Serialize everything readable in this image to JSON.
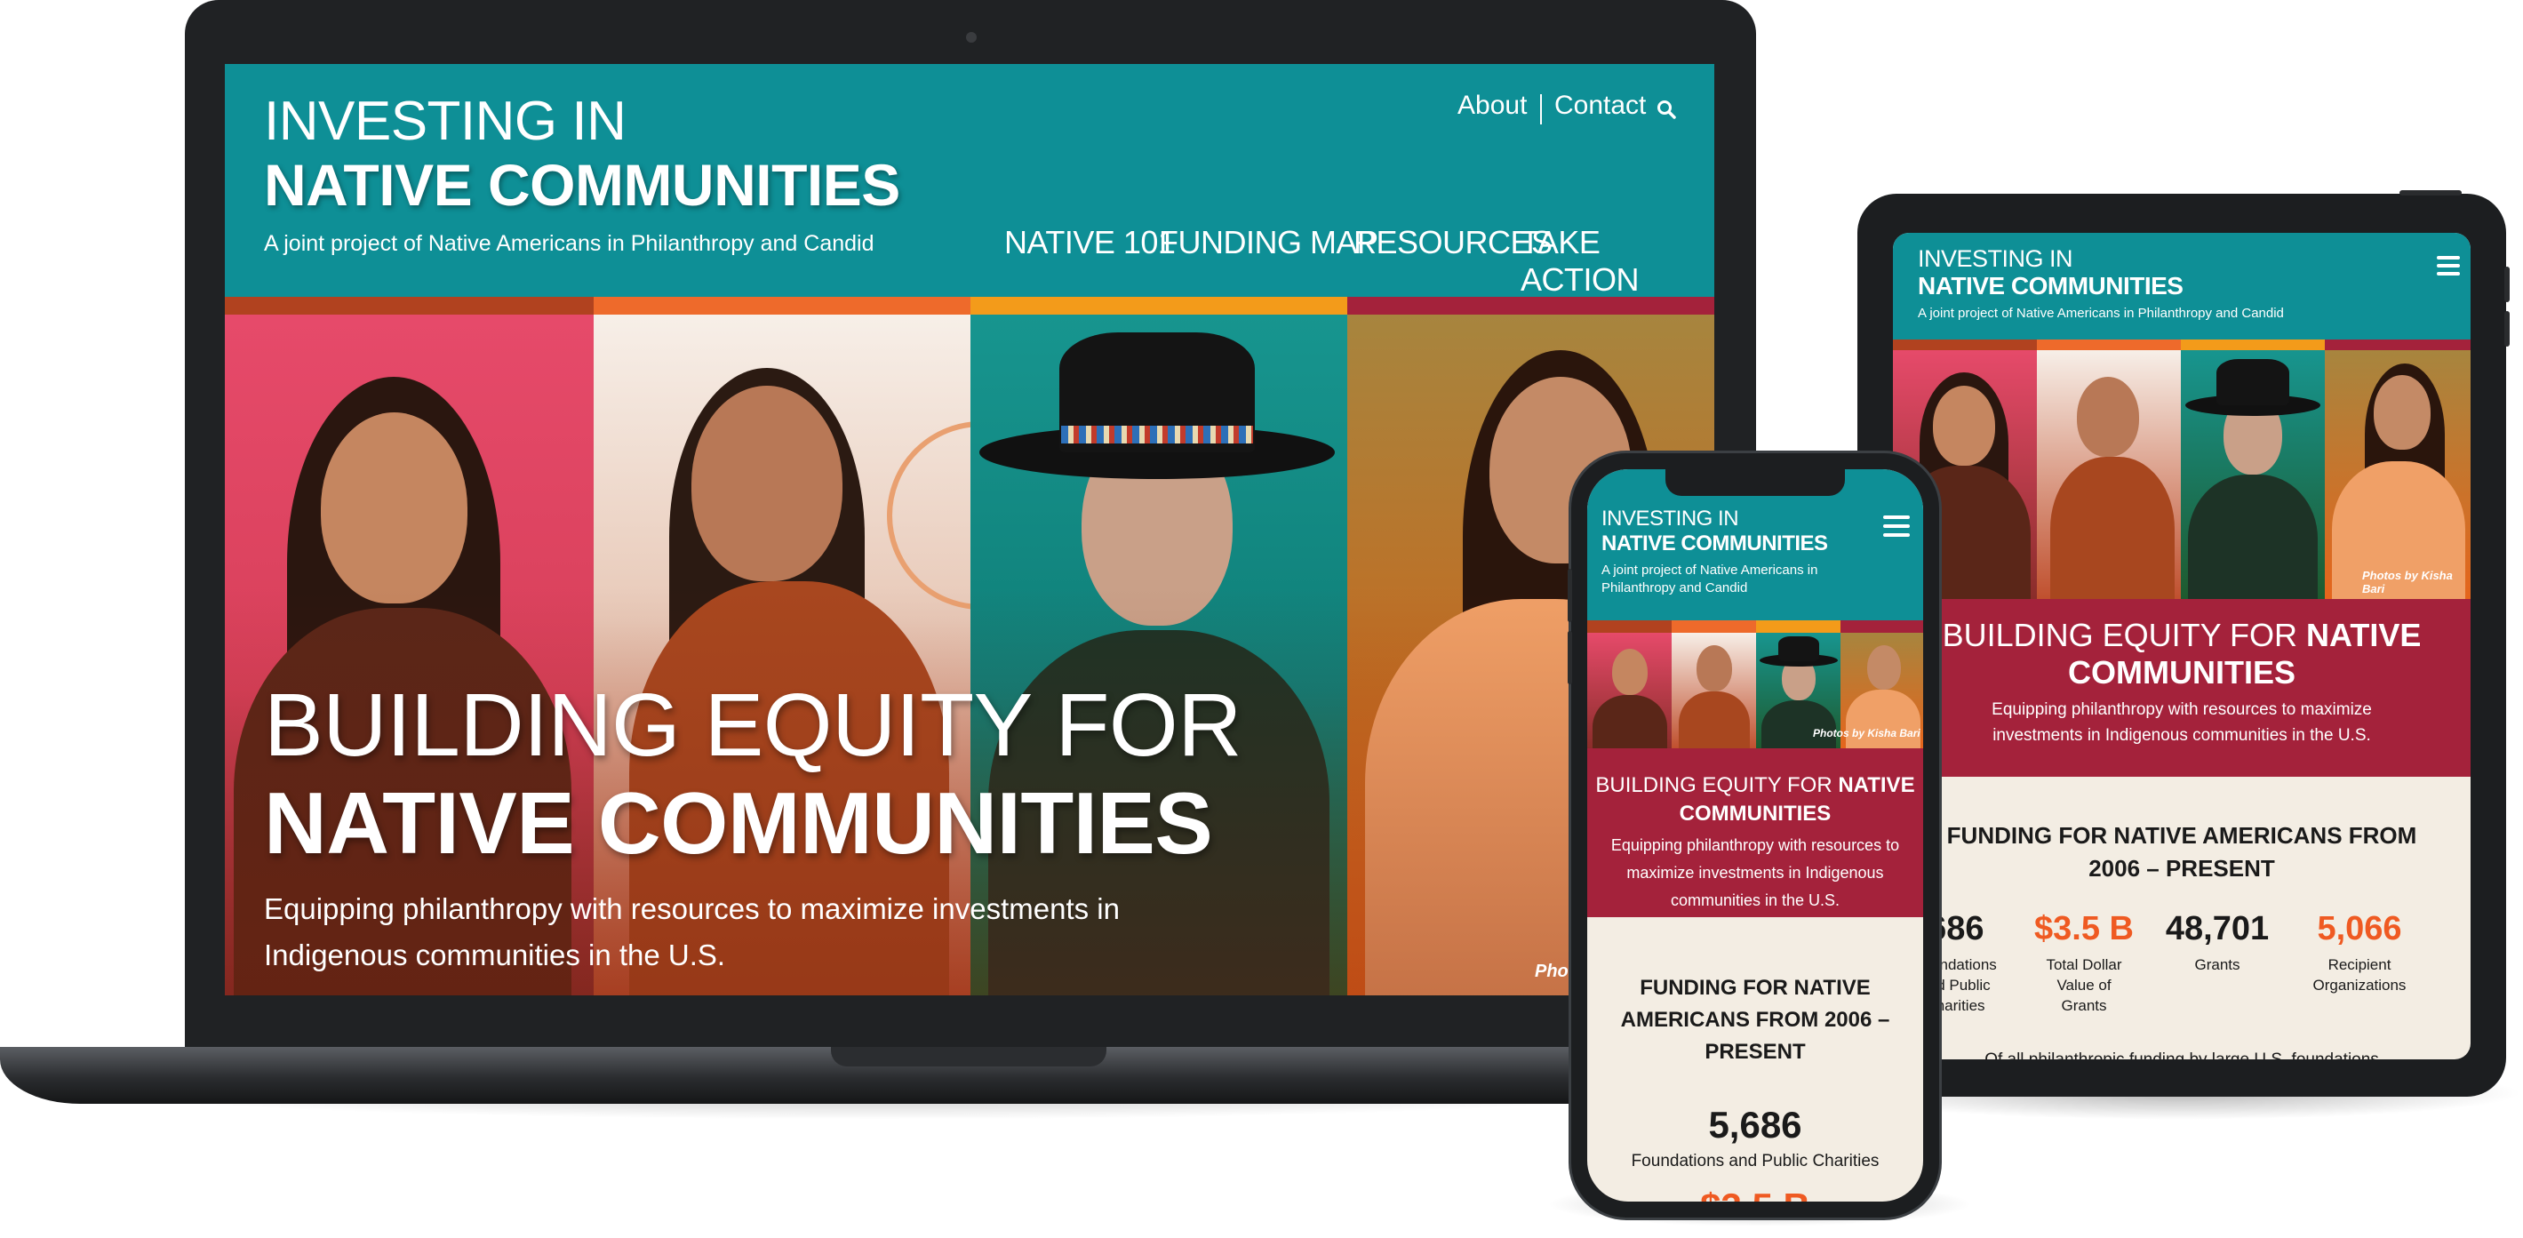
{
  "site": {
    "title_line1": "INVESTING IN",
    "title_line2": "NATIVE COMMUNITIES",
    "tagline": "A joint project of Native Americans in Philanthropy and Candid",
    "top_links": [
      "About",
      "Contact"
    ],
    "nav": [
      "NATIVE 101",
      "FUNDING MAP",
      "RESOURCES",
      "TAKE ACTION"
    ],
    "icons": {
      "search": "search-icon",
      "menu": "hamburger-menu-icon"
    }
  },
  "hero": {
    "headline_line1": "BUILDING EQUITY FOR",
    "headline_line2": "NATIVE COMMUNITIES",
    "headline_lead": "BUILDING EQUITY FOR",
    "headline_bold": "NATIVE",
    "headline_bold2": "COMMUNITIES",
    "subtext": "Equipping philanthropy with resources to maximize investments in Indigenous communities in the U.S.",
    "subtext_line1": "Equipping philanthropy with resources to maximize investments in",
    "subtext_line2": "Indigenous communities in the U.S.",
    "photo_credit": "Photos by Kisha Bari",
    "photo_credit_partial": "Phot"
  },
  "funding": {
    "heading": "FUNDING FOR NATIVE AMERICANS FROM 2006 – PRESENT",
    "stats": [
      {
        "value": "5,686",
        "label": "Foundations and Public Charities"
      },
      {
        "value": "$3.5 B",
        "label": "Total Dollar Value of Grants"
      },
      {
        "value": "48,701",
        "label": "Grants"
      },
      {
        "value": "5,066",
        "label": "Recipient Organizations"
      }
    ],
    "footnote_partial": "Of all philanthropic funding by large U.S. foundations",
    "phone_partial_value": "$3.5 B"
  },
  "colors": {
    "teal": "#0e8f96",
    "crimson": "#a4223b",
    "orange": "#ef5a22",
    "stripe_rust": "#b1421f",
    "stripe_orange": "#ee6a2b",
    "stripe_gold": "#f39b1a",
    "stripe_red": "#a4223b",
    "paper": "#f3ede3"
  }
}
